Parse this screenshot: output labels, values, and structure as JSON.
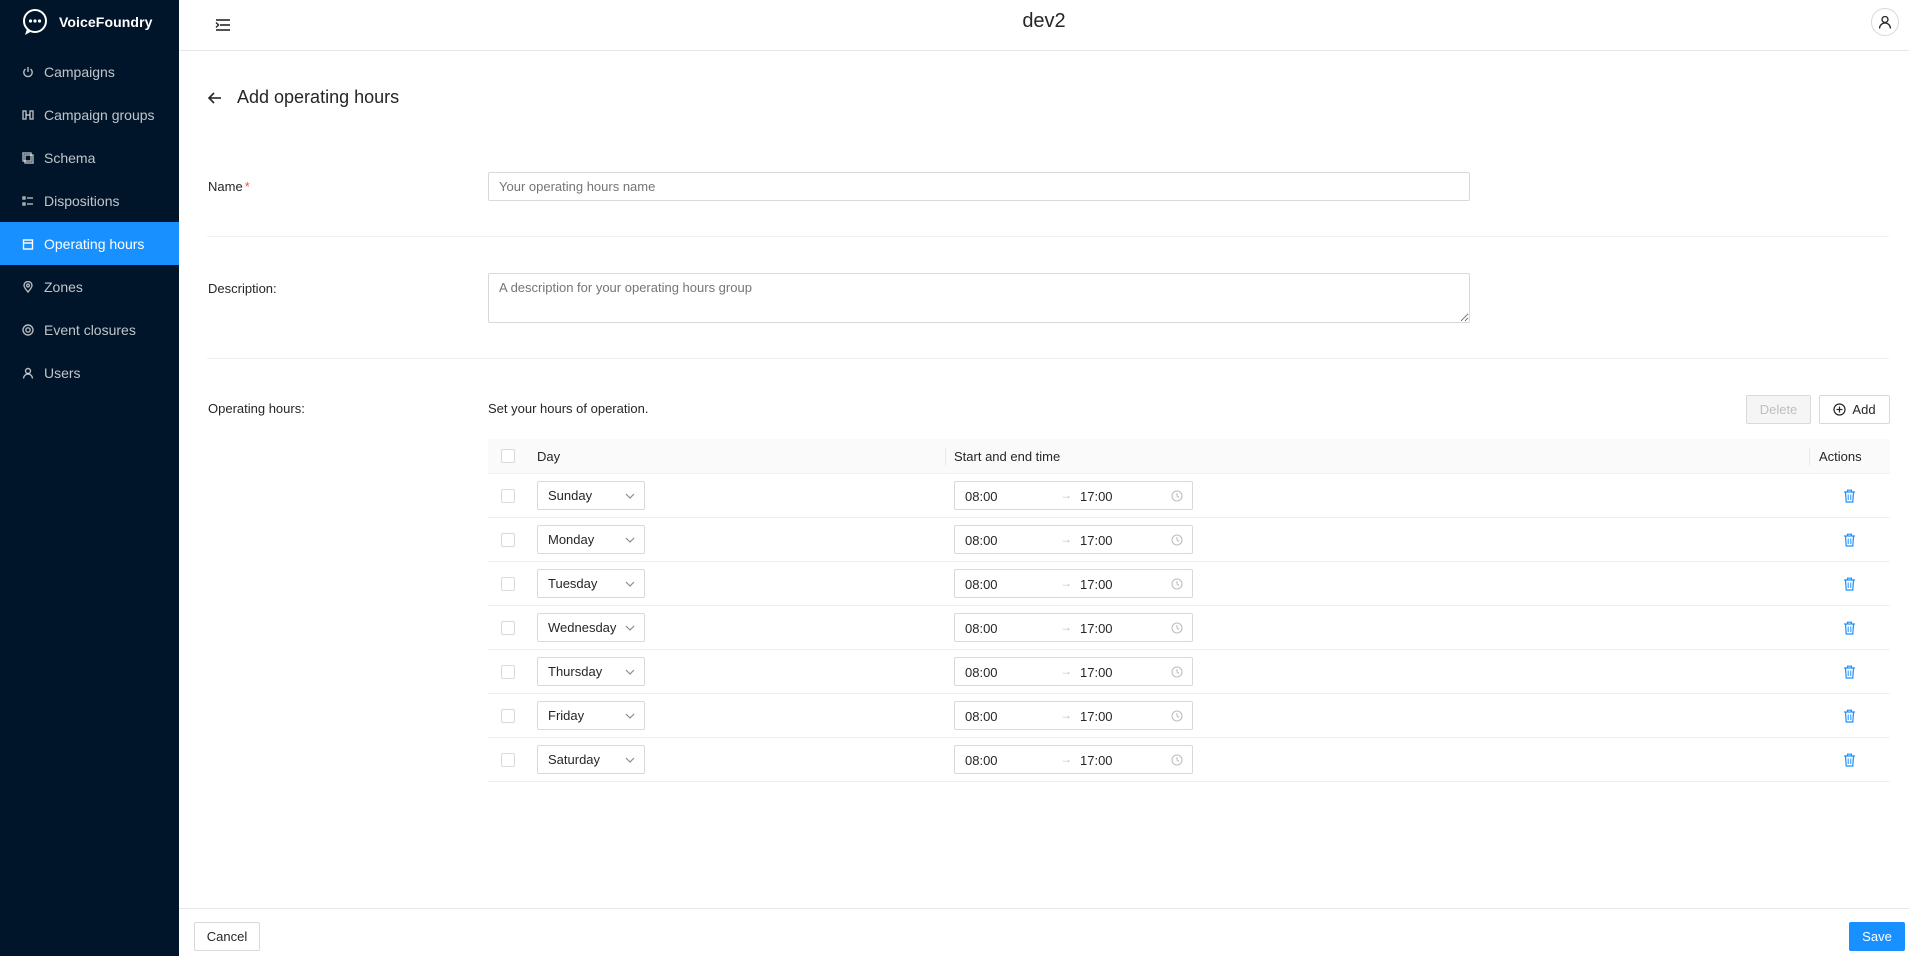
{
  "brand": {
    "name": "VoiceFoundry"
  },
  "sidebar": {
    "items": [
      {
        "label": "Campaigns",
        "icon": "power-icon",
        "active": false
      },
      {
        "label": "Campaign groups",
        "icon": "group-icon",
        "active": false
      },
      {
        "label": "Schema",
        "icon": "schema-icon",
        "active": false
      },
      {
        "label": "Dispositions",
        "icon": "list-icon",
        "active": false
      },
      {
        "label": "Operating hours",
        "icon": "calendar-icon",
        "active": true
      },
      {
        "label": "Zones",
        "icon": "location-pin-icon",
        "active": false
      },
      {
        "label": "Event closures",
        "icon": "target-icon",
        "active": false
      },
      {
        "label": "Users",
        "icon": "user-icon",
        "active": false
      }
    ]
  },
  "header": {
    "title": "dev2"
  },
  "page": {
    "title": "Add operating hours"
  },
  "form": {
    "name_label": "Name",
    "name_required_mark": "*",
    "name_placeholder": "Your operating hours name",
    "description_label": "Description:",
    "description_placeholder": "A description for your operating hours group",
    "hours_label": "Operating hours:",
    "hours_hint": "Set your hours of operation."
  },
  "toolbar": {
    "delete_label": "Delete",
    "add_label": "Add"
  },
  "table": {
    "columns": {
      "day": "Day",
      "time": "Start and end time",
      "actions": "Actions"
    },
    "rows": [
      {
        "day": "Sunday",
        "start": "08:00",
        "end": "17:00"
      },
      {
        "day": "Monday",
        "start": "08:00",
        "end": "17:00"
      },
      {
        "day": "Tuesday",
        "start": "08:00",
        "end": "17:00"
      },
      {
        "day": "Wednesday",
        "start": "08:00",
        "end": "17:00"
      },
      {
        "day": "Thursday",
        "start": "08:00",
        "end": "17:00"
      },
      {
        "day": "Friday",
        "start": "08:00",
        "end": "17:00"
      },
      {
        "day": "Saturday",
        "start": "08:00",
        "end": "17:00"
      }
    ]
  },
  "footer": {
    "cancel_label": "Cancel",
    "save_label": "Save"
  },
  "colors": {
    "sidebar_bg": "#001529",
    "accent": "#1890ff",
    "required": "#ff4d4f"
  }
}
